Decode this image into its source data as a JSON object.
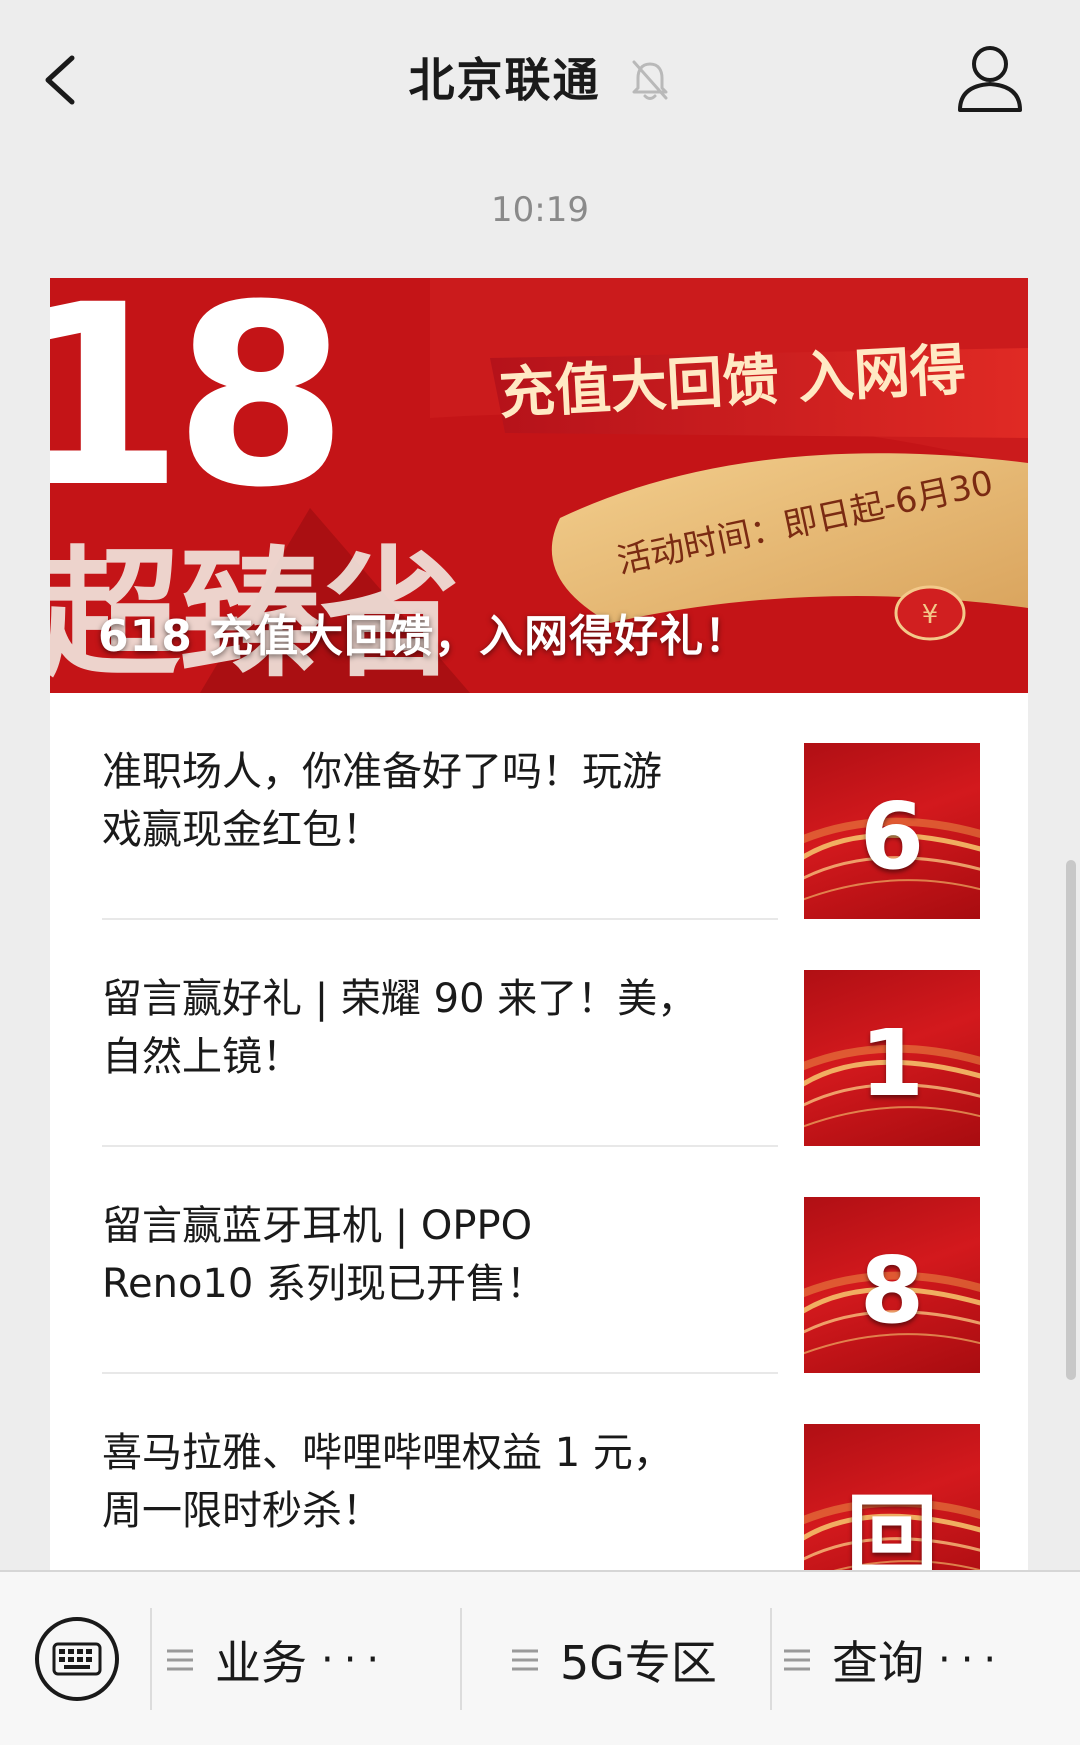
{
  "header": {
    "title": "北京联通",
    "back_icon": "chevron-left-icon",
    "mute_icon": "bell-off-icon",
    "profile_icon": "person-icon"
  },
  "timestamp": "10:19",
  "banner": {
    "caption": "618 充值大回馈，入网得好礼！",
    "art": {
      "big_number": "18",
      "ribbon_text": "充值大回馈 入网得",
      "date_text": "活动时间：即日起-6月30",
      "brush_text": "超臻省",
      "coin": "¥"
    }
  },
  "articles": [
    {
      "lines": [
        "准职场人，你准备好了吗！玩游",
        "戏赢现金红包！"
      ],
      "thumb": "6"
    },
    {
      "lines": [
        "留言赢好礼 | 荣耀 90 来了！美，",
        "自然上镜！"
      ],
      "thumb": "1"
    },
    {
      "lines": [
        "留言赢蓝牙耳机 | OPPO",
        "Reno10 系列现已开售！"
      ],
      "thumb": "8"
    },
    {
      "lines": [
        "喜马拉雅、哔哩哔哩权益 1 元，",
        "周一限时秒杀！"
      ],
      "thumb": "回"
    }
  ],
  "menu": {
    "keyboard_icon": "keyboard-icon",
    "items": [
      {
        "label": "业务",
        "dots": "···"
      },
      {
        "label": "5G专区",
        "dots": ""
      },
      {
        "label": "查询",
        "dots": "···"
      }
    ]
  },
  "colors": {
    "background": "#ededed",
    "banner_red": "#c9161a",
    "gold": "#f6c27a"
  }
}
